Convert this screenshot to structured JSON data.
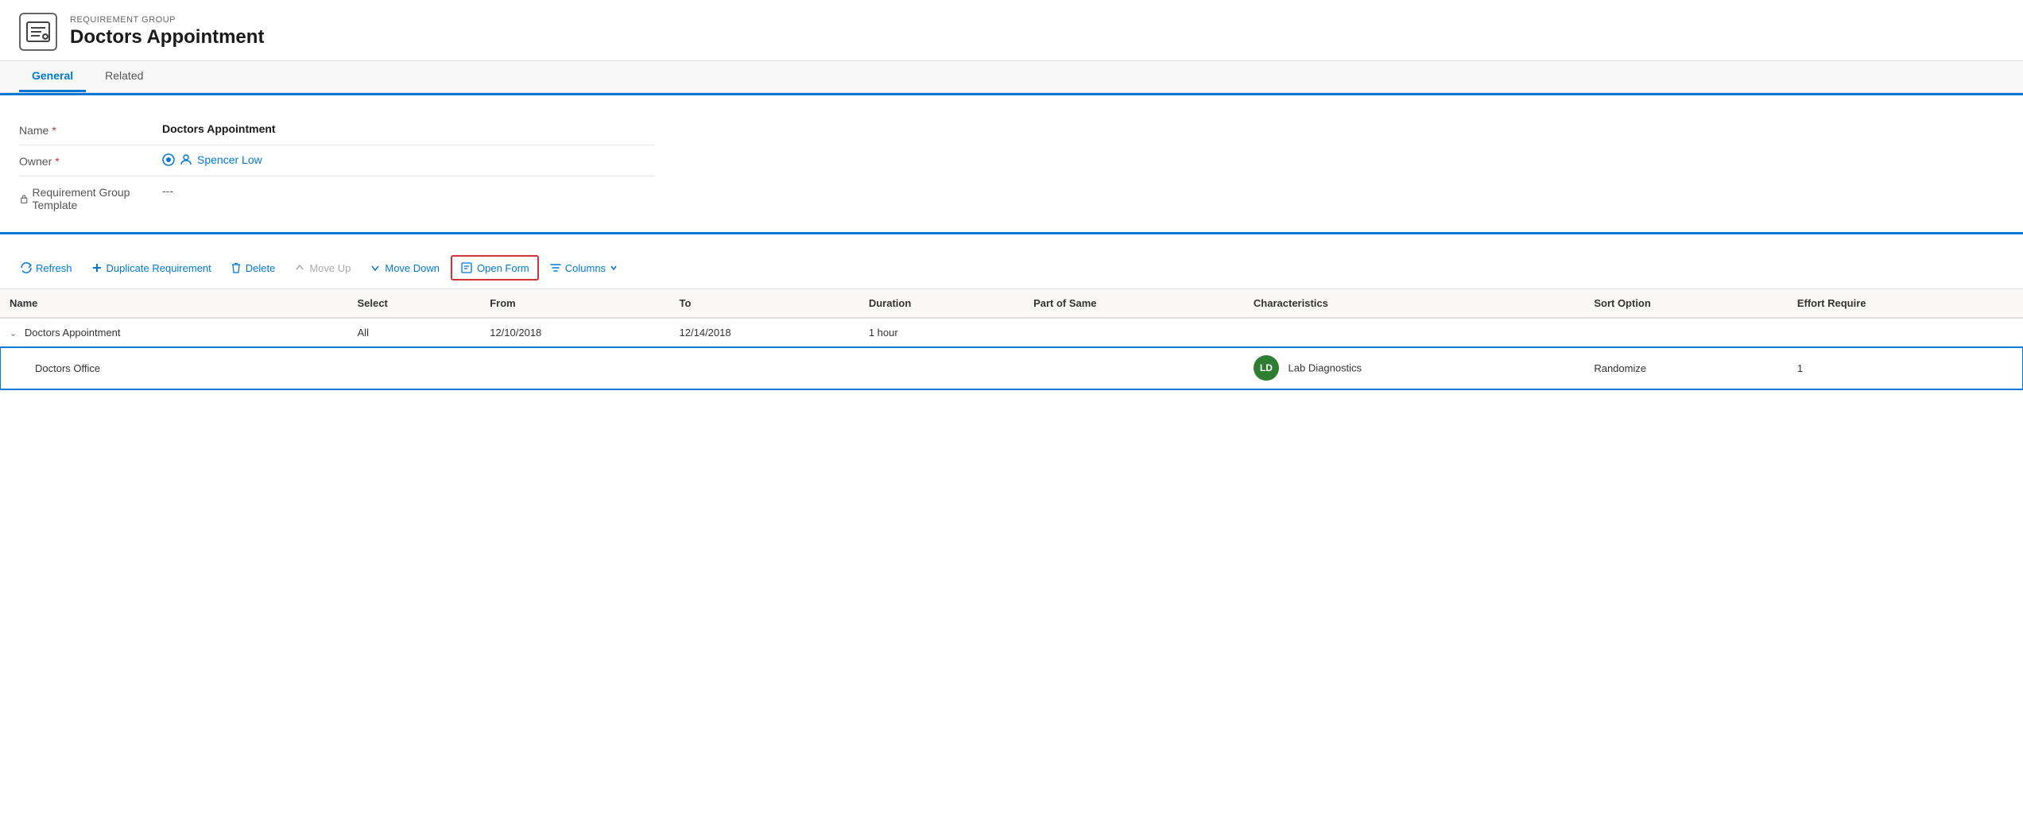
{
  "header": {
    "subtitle": "REQUIREMENT GROUP",
    "title": "Doctors Appointment"
  },
  "tabs": [
    {
      "label": "General",
      "active": true
    },
    {
      "label": "Related",
      "active": false
    }
  ],
  "form": {
    "fields": [
      {
        "label": "Name",
        "required": true,
        "value": "Doctors Appointment",
        "type": "text-bold"
      },
      {
        "label": "Owner",
        "required": true,
        "value": "Spencer Low",
        "type": "owner-link"
      },
      {
        "label": "Requirement Group Template",
        "required": false,
        "value": "---",
        "type": "normal",
        "hasLock": true
      }
    ]
  },
  "toolbar": {
    "buttons": [
      {
        "id": "refresh",
        "label": "Refresh",
        "icon": "refresh-icon",
        "disabled": false
      },
      {
        "id": "duplicate",
        "label": "Duplicate Requirement",
        "icon": "plus-icon",
        "disabled": false
      },
      {
        "id": "delete",
        "label": "Delete",
        "icon": "trash-icon",
        "disabled": false
      },
      {
        "id": "move-up",
        "label": "Move Up",
        "icon": "up-arrow-icon",
        "disabled": true
      },
      {
        "id": "move-down",
        "label": "Move Down",
        "icon": "down-arrow-icon",
        "disabled": false
      },
      {
        "id": "open-form",
        "label": "Open Form",
        "icon": "form-icon",
        "disabled": false,
        "highlighted": true
      },
      {
        "id": "columns",
        "label": "Columns",
        "icon": "filter-icon",
        "disabled": false,
        "hasDropdown": true
      }
    ]
  },
  "grid": {
    "columns": [
      {
        "id": "name",
        "label": "Name"
      },
      {
        "id": "select",
        "label": "Select"
      },
      {
        "id": "from",
        "label": "From"
      },
      {
        "id": "to",
        "label": "To"
      },
      {
        "id": "duration",
        "label": "Duration"
      },
      {
        "id": "part-of-same",
        "label": "Part of Same"
      },
      {
        "id": "characteristics",
        "label": "Characteristics"
      },
      {
        "id": "sort-option",
        "label": "Sort Option"
      },
      {
        "id": "effort-required",
        "label": "Effort Require"
      }
    ],
    "rows": [
      {
        "type": "group",
        "name": "Doctors Appointment",
        "expanded": true,
        "select": "All",
        "from": "12/10/2018",
        "to": "12/14/2018",
        "duration": "1 hour",
        "partOfSame": "",
        "characteristics": "",
        "sortOption": "",
        "effortRequired": "",
        "selected": false
      },
      {
        "type": "child",
        "name": "Doctors Office",
        "select": "",
        "from": "",
        "to": "",
        "duration": "",
        "partOfSame": "",
        "characteristicsBadge": "LD",
        "characteristicsName": "Lab Diagnostics",
        "sortOption": "Randomize",
        "effortRequired": "1",
        "selected": true
      }
    ]
  }
}
